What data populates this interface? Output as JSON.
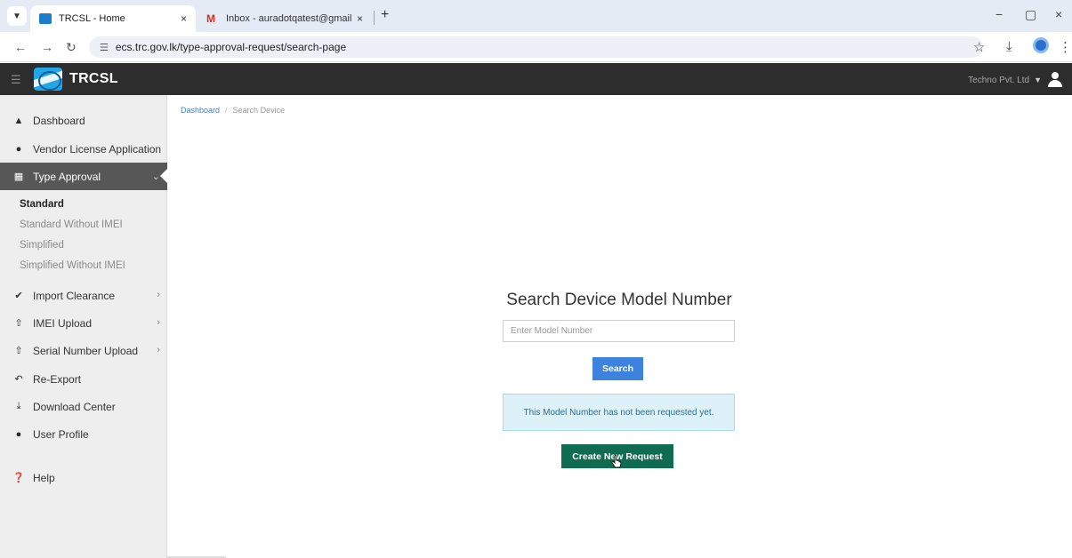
{
  "browser": {
    "tabs": [
      {
        "title": "TRCSL - Home",
        "favicon": "trcsl-favicon",
        "active": true
      },
      {
        "title": "Inbox - auradotqatest@gmail.c",
        "favicon": "gmail-icon",
        "active": false
      }
    ],
    "tab_close": "×",
    "new_tab": "+",
    "url": "ecs.trc.gov.lk/type-approval-request/search-page",
    "window_controls": {
      "minimize": "−",
      "maximize": "▢",
      "close": "×"
    }
  },
  "header": {
    "brand": "TRCSL",
    "company": "Techno Pvt. Ltd",
    "colors": {
      "bar": "#2d2d2d",
      "logo": "#22a7e6"
    }
  },
  "sidebar": {
    "items": [
      {
        "label": "Dashboard",
        "icon": "home-icon"
      },
      {
        "label": "Vendor License Application",
        "icon": "user-icon"
      },
      {
        "label": "Type Approval",
        "icon": "table-icon",
        "active": true
      },
      {
        "label": "Import Clearance",
        "icon": "check-circle-icon",
        "has_chevron": true
      },
      {
        "label": "IMEI Upload",
        "icon": "upload-icon",
        "has_chevron": true
      },
      {
        "label": "Serial Number Upload",
        "icon": "upload-icon",
        "has_chevron": true
      },
      {
        "label": "Re-Export",
        "icon": "reply-icon"
      },
      {
        "label": "Download Center",
        "icon": "download-icon"
      },
      {
        "label": "User Profile",
        "icon": "user-icon"
      },
      {
        "label": "Help",
        "icon": "question-circle-icon"
      }
    ],
    "type_approval_sub": [
      "Standard",
      "Standard Without IMEI",
      "Simplified",
      "Simplified Without IMEI"
    ]
  },
  "breadcrumb": {
    "home": "Dashboard",
    "separator": "/",
    "current": "Search Device"
  },
  "search": {
    "title": "Search Device Model Number",
    "placeholder": "Enter Model Number",
    "button": "Search",
    "button_color": "#3d82dc"
  },
  "result": {
    "message": "This Model Number has not been requested yet.",
    "create_button": "Create New Request",
    "create_color": "#0f6c50"
  }
}
